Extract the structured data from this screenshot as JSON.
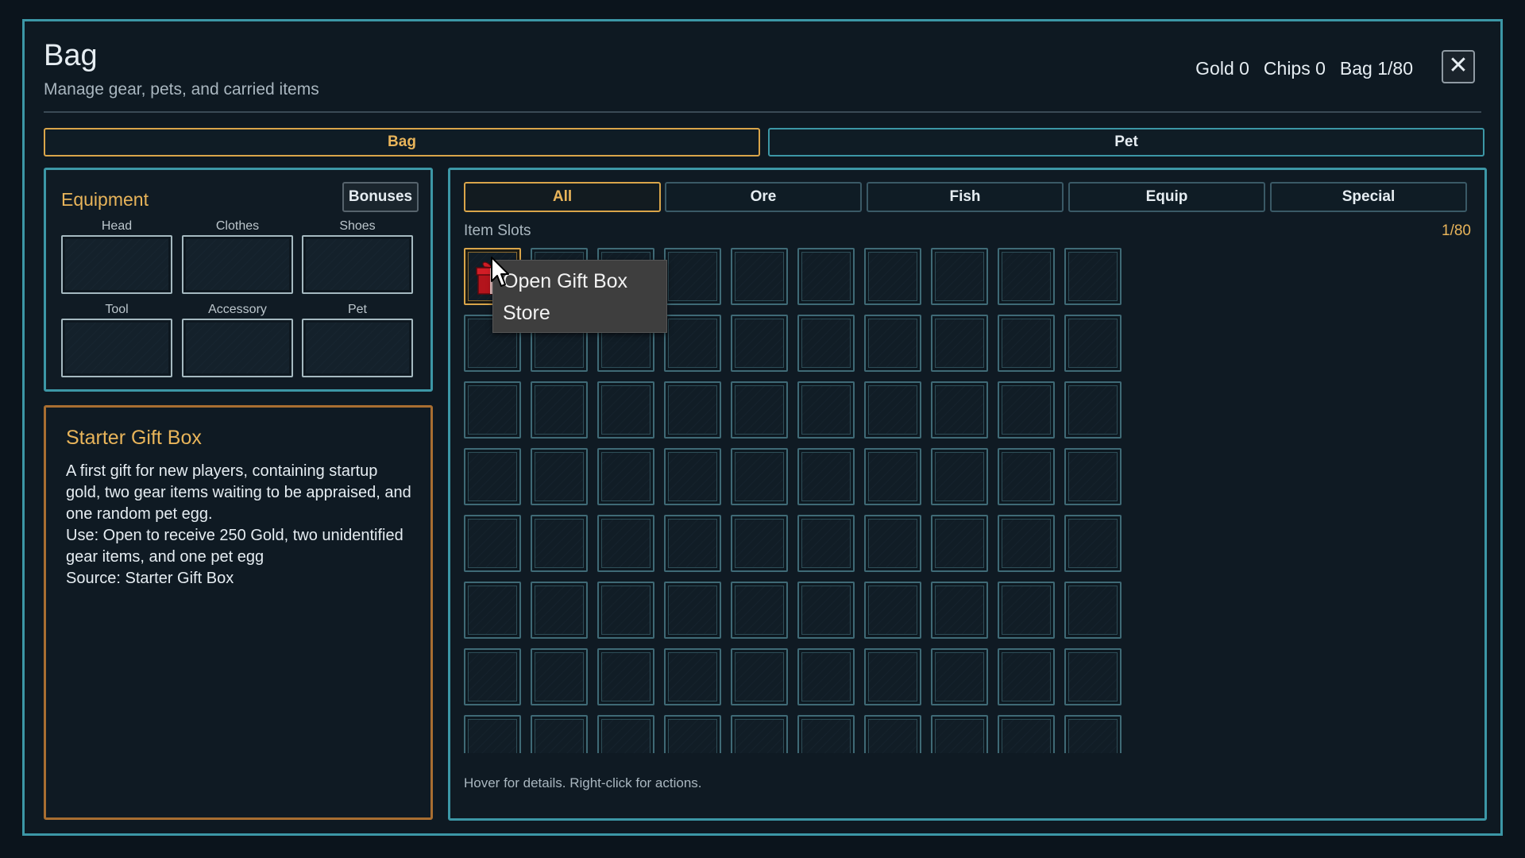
{
  "window": {
    "title": "Bag",
    "subtitle": "Manage gear, pets, and carried items",
    "stats": {
      "gold": "Gold 0",
      "chips": "Chips 0",
      "bag": "Bag 1/80"
    },
    "close_icon": "close-x-icon"
  },
  "main_tabs": [
    {
      "label": "Bag",
      "active": true
    },
    {
      "label": "Pet",
      "active": false
    }
  ],
  "equipment": {
    "title": "Equipment",
    "bonuses_label": "Bonuses",
    "slots": [
      "Head",
      "Clothes",
      "Shoes",
      "Tool",
      "Accessory",
      "Pet"
    ]
  },
  "item_detail": {
    "title": "Starter Gift Box",
    "lines": [
      "A first gift for new players, containing startup gold, two gear items waiting to be appraised, and one random pet egg.",
      "Use: Open to receive 250 Gold, two unidentified gear items, and one pet egg",
      "Source: Starter Gift Box"
    ]
  },
  "inventory": {
    "filters": [
      {
        "label": "All",
        "active": true
      },
      {
        "label": "Ore",
        "active": false
      },
      {
        "label": "Fish",
        "active": false
      },
      {
        "label": "Equip",
        "active": false
      },
      {
        "label": "Special",
        "active": false
      }
    ],
    "slots_label": "Item Slots",
    "slots_count": "1/80",
    "total_slots": 80,
    "items": [
      {
        "slot": 0,
        "icon": "gift-box-icon",
        "name": "Starter Gift Box"
      }
    ],
    "hint": "Hover for details. Right-click for actions."
  },
  "context_menu": {
    "items": [
      "Open Gift Box",
      "Store"
    ]
  },
  "colors": {
    "accent_teal": "#3c97a6",
    "accent_gold": "#e8b45a",
    "background": "#0e1922"
  }
}
